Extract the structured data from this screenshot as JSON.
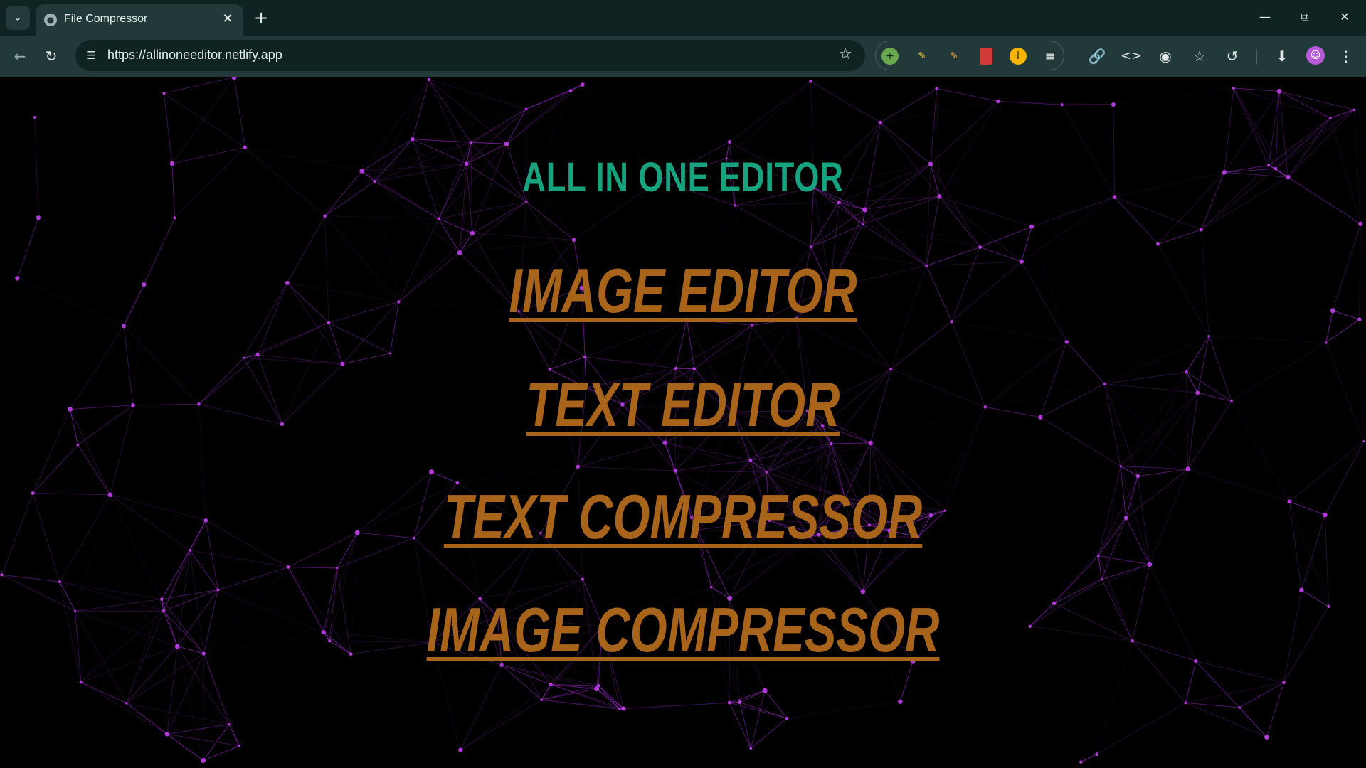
{
  "browser": {
    "tab_title": "File Compressor",
    "url": "https://allinoneeditor.netlify.app"
  },
  "page": {
    "title": "ALL IN ONE EDITOR",
    "links": [
      {
        "label": "IMAGE EDITOR"
      },
      {
        "label": "TEXT EDITOR"
      },
      {
        "label": "TEXT COMPRESSOR"
      },
      {
        "label": "IMAGE COMPRESSOR"
      }
    ]
  },
  "colors": {
    "title": "#16a37d",
    "link": "#a8641a",
    "network": "#9b2bc9",
    "background": "#000000"
  }
}
